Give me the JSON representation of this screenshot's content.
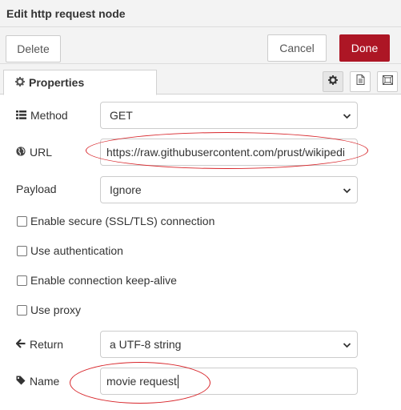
{
  "dialog": {
    "title": "Edit http request node",
    "delete_label": "Delete",
    "cancel_label": "Cancel",
    "done_label": "Done",
    "done_color": "#ad1625"
  },
  "tabs": {
    "properties_label": "Properties",
    "properties_icon": "gear-icon",
    "side_icons": [
      "gear-icon",
      "document-icon",
      "frame-icon"
    ]
  },
  "form": {
    "method": {
      "label": "Method",
      "icon": "list-icon",
      "value": "GET"
    },
    "url": {
      "label": "URL",
      "icon": "globe-icon",
      "value": "https://raw.githubusercontent.com/prust/wikipedi"
    },
    "payload": {
      "label": "Payload",
      "value": "Ignore"
    },
    "checkboxes": [
      {
        "label": "Enable secure (SSL/TLS) connection",
        "checked": false
      },
      {
        "label": "Use authentication",
        "checked": false
      },
      {
        "label": "Enable connection keep-alive",
        "checked": false
      },
      {
        "label": "Use proxy",
        "checked": false
      }
    ],
    "return": {
      "label": "Return",
      "icon": "arrow-left-icon",
      "value": "a UTF-8 string"
    },
    "name": {
      "label": "Name",
      "icon": "tag-icon",
      "value": "movie request"
    }
  },
  "annotation_color": "#d8262b"
}
